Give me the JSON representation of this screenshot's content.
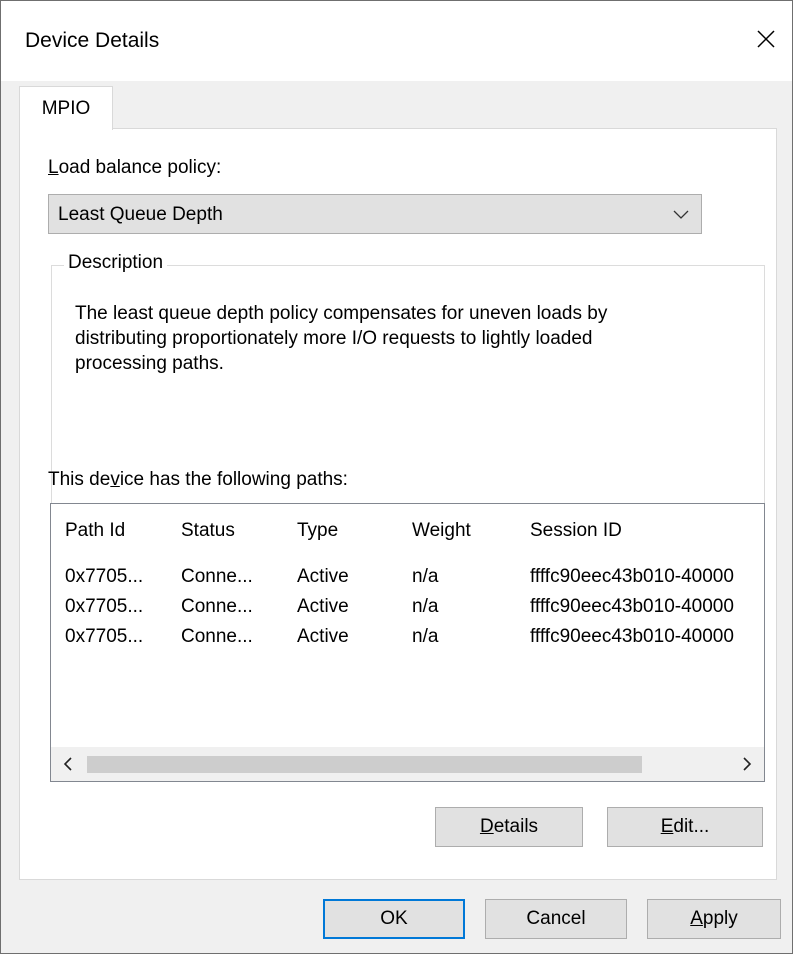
{
  "window": {
    "title": "Device Details"
  },
  "tabs": [
    {
      "label": "MPIO"
    }
  ],
  "load_balance": {
    "label_first": "L",
    "label_rest": "oad balance policy:",
    "selected": "Least Queue Depth"
  },
  "description": {
    "legend": "Description",
    "line1": "The least queue depth policy compensates for uneven loads by",
    "line2": "distributing proportionately more I/O requests to lightly loaded",
    "line3": "processing paths."
  },
  "paths": {
    "label_pre": "This de",
    "label_accel": "v",
    "label_post": "ice has the following paths:",
    "columns": [
      "Path Id",
      "Status",
      "Type",
      "Weight",
      "Session ID"
    ],
    "rows": [
      [
        "0x7705...",
        "Conne...",
        "Active",
        "n/a",
        "ffffc90eec43b010-40000"
      ],
      [
        "0x7705...",
        "Conne...",
        "Active",
        "n/a",
        "ffffc90eec43b010-40000"
      ],
      [
        "0x7705...",
        "Conne...",
        "Active",
        "n/a",
        "ffffc90eec43b010-40000"
      ]
    ]
  },
  "buttons": {
    "details_accel": "D",
    "details_rest": "etails",
    "edit_accel": "E",
    "edit_rest": "dit...",
    "ok": "OK",
    "cancel": "Cancel",
    "apply_accel": "A",
    "apply_rest": "pply"
  },
  "colors": {
    "accent": "#0078d7",
    "button_face": "#e1e1e1",
    "dialog_bg": "#f0f0f0"
  }
}
